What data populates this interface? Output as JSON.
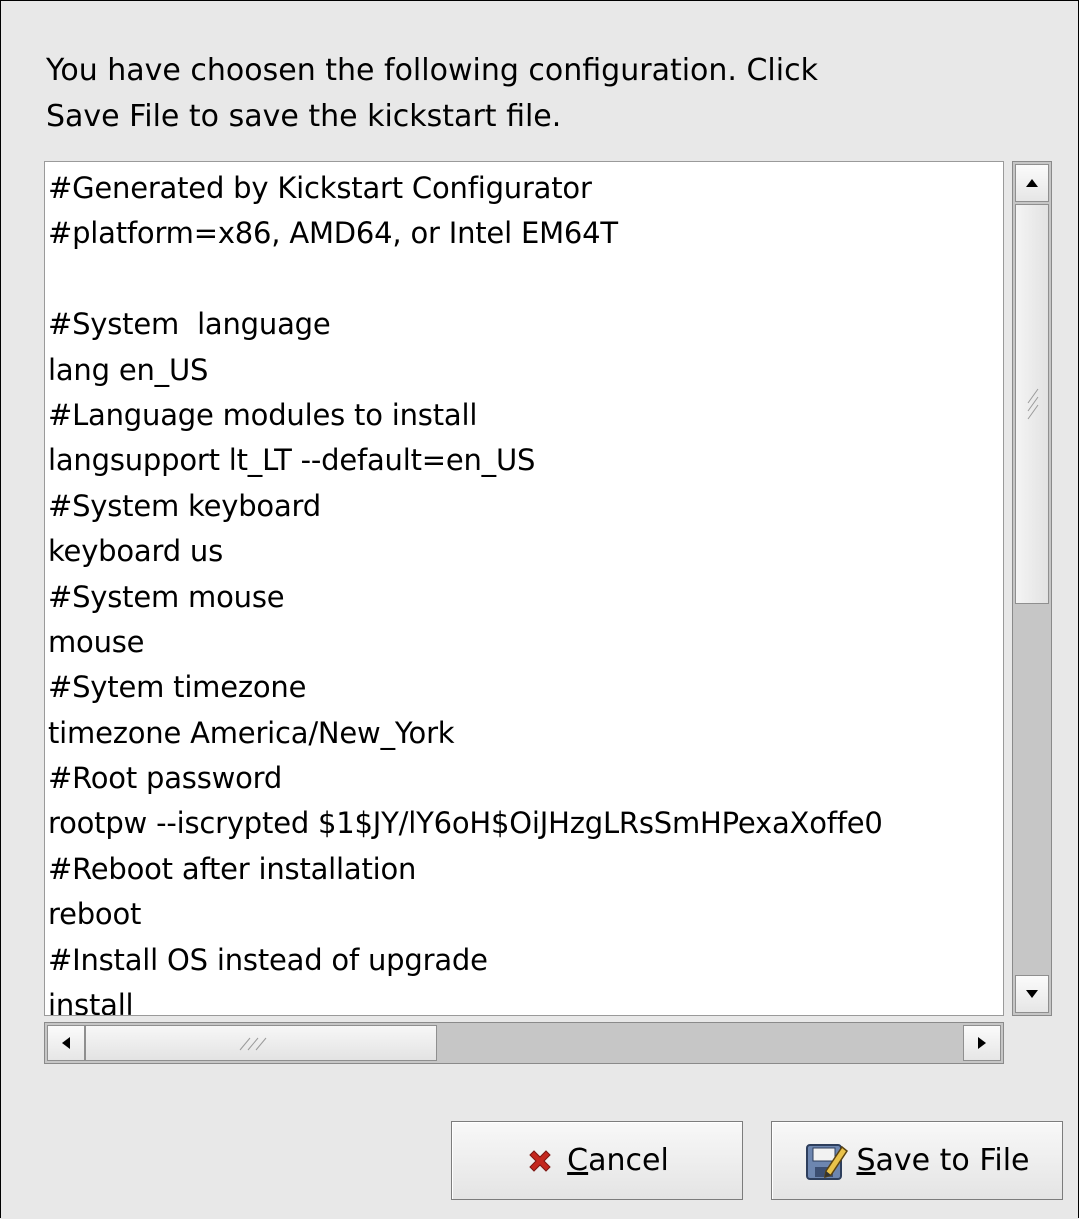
{
  "intro": {
    "line1": "You have choosen the following configuration.  Click",
    "line2": "Save File to save the kickstart file."
  },
  "config_lines": [
    "#Generated by Kickstart Configurator",
    "#platform=x86, AMD64, or Intel EM64T",
    "",
    "#System  language",
    "lang en_US",
    "#Language modules to install",
    "langsupport lt_LT --default=en_US",
    "#System keyboard",
    "keyboard us",
    "#System mouse",
    "mouse",
    "#Sytem timezone",
    "timezone America/New_York",
    "#Root password",
    "rootpw --iscrypted $1$JY/lY6oH$OiJHzgLRsSmHPexaXoffe0",
    "#Reboot after installation",
    "reboot",
    "#Install OS instead of upgrade",
    "install"
  ],
  "buttons": {
    "cancel": {
      "mnemonic": "C",
      "rest": "ancel",
      "icon": "cancel-x-icon",
      "icon_color": "#c4271e"
    },
    "save": {
      "mnemonic": "S",
      "rest": "ave to File",
      "icon": "save-disk-icon"
    }
  },
  "scrollbars": {
    "vertical_icons": [
      "arrow-up-icon",
      "arrow-down-icon"
    ],
    "horizontal_icons": [
      "arrow-left-icon",
      "arrow-right-icon"
    ]
  }
}
